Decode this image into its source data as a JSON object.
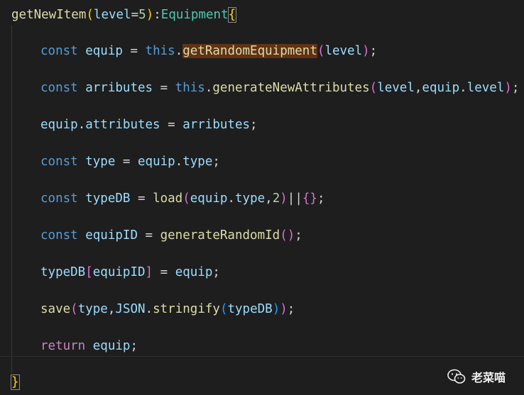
{
  "editor": {
    "lines": {
      "l1": {
        "fn_name": "getNewItem",
        "open_paren": "(",
        "param": "level",
        "eq": "=",
        "default": "5",
        "close_paren": ")",
        "colon": ":",
        "ret_type": "Equipment",
        "open_brace": "{"
      },
      "l2": {
        "kw": "const",
        "var": "equip",
        "eq": " = ",
        "this": "this",
        "dot": ".",
        "method": "getRandomEquipment",
        "open": "(",
        "arg": "level",
        "close": ")",
        "semi": ";"
      },
      "l3": {
        "kw": "const",
        "var": "arributes",
        "eq": " = ",
        "this": "this",
        "dot": ".",
        "method": "generateNewAttributes",
        "open": "(",
        "arg1": "level",
        "comma": ",",
        "arg2_obj": "equip",
        "arg2_dot": ".",
        "arg2_prop": "level",
        "close": ")",
        "semi": ";"
      },
      "l4": {
        "obj": "equip",
        "dot": ".",
        "prop": "attributes",
        "eq": " = ",
        "val": "arributes",
        "semi": ";"
      },
      "l5": {
        "kw": "const",
        "var": "type",
        "eq": " = ",
        "obj": "equip",
        "dot": ".",
        "prop": "type",
        "semi": ";"
      },
      "l6": {
        "kw": "const",
        "var": "typeDB",
        "eq": " = ",
        "fn": "load",
        "open": "(",
        "obj": "equip",
        "dot": ".",
        "prop": "type",
        "comma": ",",
        "num": "2",
        "close": ")",
        "or": "||",
        "obj_open": "{",
        "obj_close": "}",
        "semi": ";"
      },
      "l7": {
        "kw": "const",
        "var": "equipID",
        "eq": " = ",
        "fn": "generateRandomId",
        "parens": "()",
        "semi": ";"
      },
      "l8": {
        "obj": "typeDB",
        "open": "[",
        "key": "equipID",
        "close": "]",
        "eq": " = ",
        "val": "equip",
        "semi": ";"
      },
      "l9": {
        "fn": "save",
        "open": "(",
        "arg1": "type",
        "comma": ",",
        "json": "JSON",
        "dot": ".",
        "method": "stringify",
        "inner_open": "(",
        "arg": "typeDB",
        "inner_close": ")",
        "close": ")",
        "semi": ";"
      },
      "l10": {
        "kw": "return",
        "val": "equip",
        "semi": ";"
      },
      "l11": {
        "close_brace": "}"
      }
    }
  },
  "watermark": {
    "label": "老菜喵",
    "icon": "wechat-icon"
  },
  "colors": {
    "background": "#1e1e1e",
    "keyword": "#569cd6",
    "control_keyword": "#c586c0",
    "variable": "#9cdcfe",
    "function": "#dcdcaa",
    "type": "#4ec9b0",
    "number": "#b5cea8",
    "bracket_level1": "#ffd700",
    "bracket_level2": "#da70d6",
    "bracket_level3": "#179fff",
    "selection_highlight": "#613214"
  }
}
